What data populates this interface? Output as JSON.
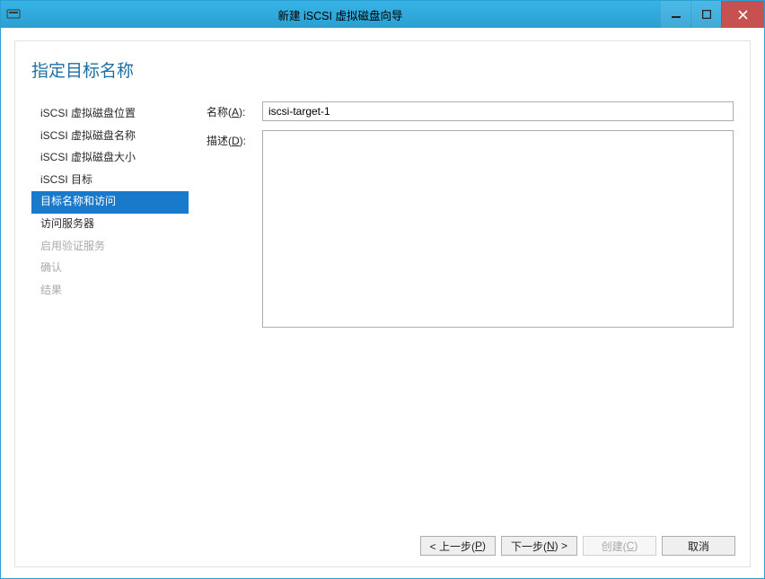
{
  "titlebar": {
    "title": "新建 iSCSI 虚拟磁盘向导"
  },
  "page": {
    "title": "指定目标名称"
  },
  "sidebar": {
    "items": [
      {
        "label": "iSCSI 虚拟磁盘位置",
        "state": "normal"
      },
      {
        "label": "iSCSI 虚拟磁盘名称",
        "state": "normal"
      },
      {
        "label": "iSCSI 虚拟磁盘大小",
        "state": "normal"
      },
      {
        "label": "iSCSI 目标",
        "state": "normal"
      },
      {
        "label": "目标名称和访问",
        "state": "active"
      },
      {
        "label": "访问服务器",
        "state": "normal"
      },
      {
        "label": "启用验证服务",
        "state": "disabled"
      },
      {
        "label": "确认",
        "state": "disabled"
      },
      {
        "label": "结果",
        "state": "disabled"
      }
    ]
  },
  "form": {
    "name_label_pre": "名称(",
    "name_label_key": "A",
    "name_label_post": "):",
    "name_value": "iscsi-target-1",
    "desc_label_pre": "描述(",
    "desc_label_key": "D",
    "desc_label_post": "):",
    "desc_value": ""
  },
  "buttons": {
    "prev_pre": "< 上一步(",
    "prev_key": "P",
    "prev_post": ")",
    "next_pre": "下一步(",
    "next_key": "N",
    "next_post": ") >",
    "create_pre": "创建(",
    "create_key": "C",
    "create_post": ")",
    "cancel": "取消"
  }
}
